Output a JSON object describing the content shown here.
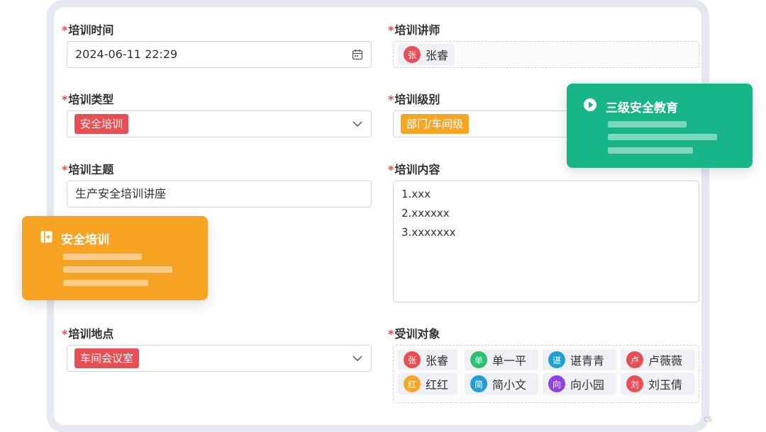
{
  "form": {
    "required_mark": "*",
    "time": {
      "label": "培训时间",
      "value": "2024-06-11 22:29",
      "icon": "calendar-icon"
    },
    "lecturer": {
      "label": "培训讲师",
      "chip": {
        "avatar": "张",
        "name": "张睿",
        "color": "#e84f55"
      }
    },
    "type": {
      "label": "培训类型",
      "tag": "安全培训",
      "tag_color": "#e84f55",
      "icon": "chevron-down-icon"
    },
    "level": {
      "label": "培训级别",
      "tag": "部门/车间级",
      "tag_color": "#f5a623"
    },
    "topic": {
      "label": "培训主题",
      "value": "生产安全培训讲座"
    },
    "content": {
      "label": "培训内容",
      "lines": [
        "1.xxx",
        "2.xxxxxx",
        "3.xxxxxxx"
      ]
    },
    "location": {
      "label": "培训地点",
      "tag": "车间会议室",
      "tag_color": "#e84f55",
      "icon": "chevron-down-icon"
    },
    "trainees": {
      "label": "受训对象",
      "people": [
        {
          "avatar": "张",
          "name": "张睿",
          "color": "#e84f55"
        },
        {
          "avatar": "单",
          "name": "单一平",
          "color": "#2fbf71"
        },
        {
          "avatar": "谌",
          "name": "谌青青",
          "color": "#1e9fd8"
        },
        {
          "avatar": "卢",
          "name": "卢薇薇",
          "color": "#e84f55"
        },
        {
          "avatar": "红",
          "name": "红红",
          "color": "#f5a623"
        },
        {
          "avatar": "简",
          "name": "简小文",
          "color": "#1e9fd8"
        },
        {
          "avatar": "向",
          "name": "向小园",
          "color": "#8e44e0"
        },
        {
          "avatar": "刘",
          "name": "刘玉倩",
          "color": "#e84f55"
        }
      ]
    }
  },
  "cards": {
    "safety": {
      "title": "安全培训",
      "icon": "board-icon",
      "color": "#f7a324"
    },
    "education": {
      "title": "三级安全教育",
      "icon": "play-circle-icon",
      "color": "#17b587"
    }
  },
  "watermark": "CS"
}
